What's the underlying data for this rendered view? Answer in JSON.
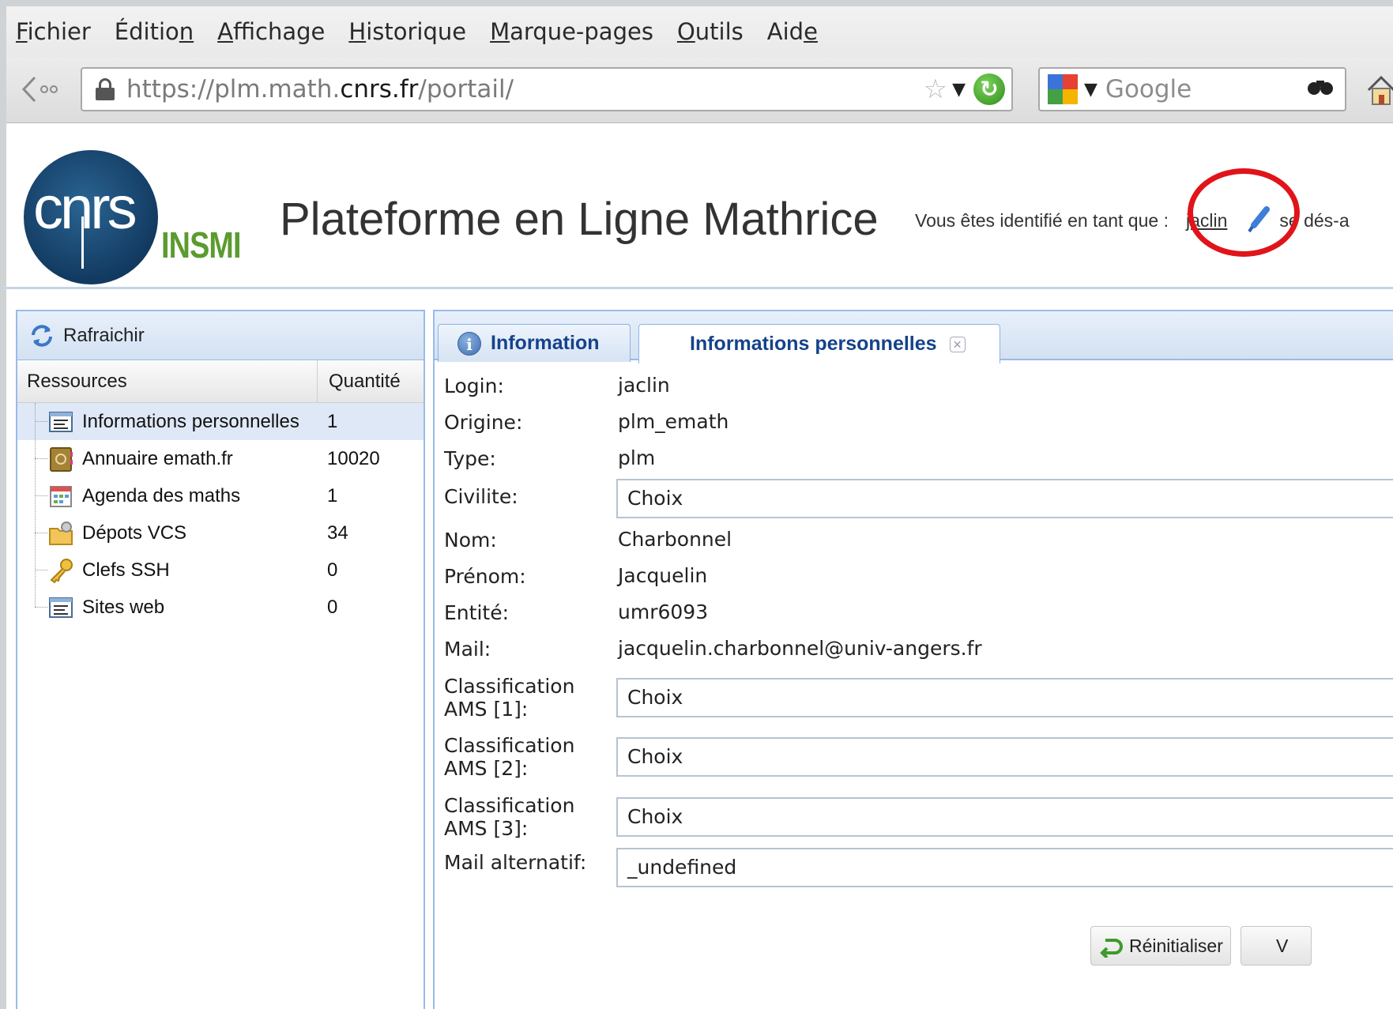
{
  "menu": [
    {
      "pre": "",
      "ul": "F",
      "post": "ichier"
    },
    {
      "pre": "Éditio",
      "ul": "n",
      "post": ""
    },
    {
      "pre": "",
      "ul": "A",
      "post": "ffichage"
    },
    {
      "pre": "",
      "ul": "H",
      "post": "istorique"
    },
    {
      "pre": "",
      "ul": "M",
      "post": "arque-pages"
    },
    {
      "pre": "",
      "ul": "O",
      "post": "utils"
    },
    {
      "pre": "Aid",
      "ul": "e",
      "post": ""
    }
  ],
  "url": {
    "scheme_prefix": "https://plm.math.",
    "host": "cnrs.fr",
    "path": "/portail/"
  },
  "search": {
    "placeholder": "Google"
  },
  "header": {
    "logo_text": "cnrs",
    "logo_subtext": "INSMI",
    "title": "Plateforme en Ligne Mathrice",
    "identity_text": "Vous êtes identifié en tant que :",
    "username": "jaclin",
    "logout_text": "se dés-a"
  },
  "left": {
    "refresh_label": "Rafraichir",
    "col_resources": "Ressources",
    "col_quantity": "Quantité",
    "items": [
      {
        "label": "Informations personnelles",
        "qty": "1"
      },
      {
        "label": "Annuaire emath.fr",
        "qty": "10020"
      },
      {
        "label": "Agenda des maths",
        "qty": "1"
      },
      {
        "label": "Dépots VCS",
        "qty": "34"
      },
      {
        "label": "Clefs SSH",
        "qty": "0"
      },
      {
        "label": "Sites web",
        "qty": "0"
      }
    ]
  },
  "tabs": {
    "info": "Information",
    "perso": "Informations personnelles"
  },
  "form": {
    "login_label": "Login:",
    "login_value": "jaclin",
    "origine_label": "Origine:",
    "origine_value": "plm_emath",
    "type_label": "Type:",
    "type_value": "plm",
    "civilite_label": "Civilite:",
    "civilite_value": "Choix",
    "nom_label": "Nom:",
    "nom_value": "Charbonnel",
    "prenom_label": "Prénom:",
    "prenom_value": "Jacquelin",
    "entite_label": "Entité:",
    "entite_value": "umr6093",
    "mail_label": "Mail:",
    "mail_value": "jacquelin.charbonnel@univ-angers.fr",
    "ams1_label_1": "Classification",
    "ams1_label_2": "AMS [1]:",
    "ams1_value": "Choix",
    "ams2_label_1": "Classification",
    "ams2_label_2": "AMS [2]:",
    "ams2_value": "Choix",
    "ams3_label_1": "Classification",
    "ams3_label_2": "AMS [3]:",
    "ams3_value": "Choix",
    "mail_alt_label": "Mail alternatif:",
    "mail_alt_value": "_undefined"
  },
  "buttons": {
    "reset": "Réinitialiser",
    "validate": "V"
  }
}
